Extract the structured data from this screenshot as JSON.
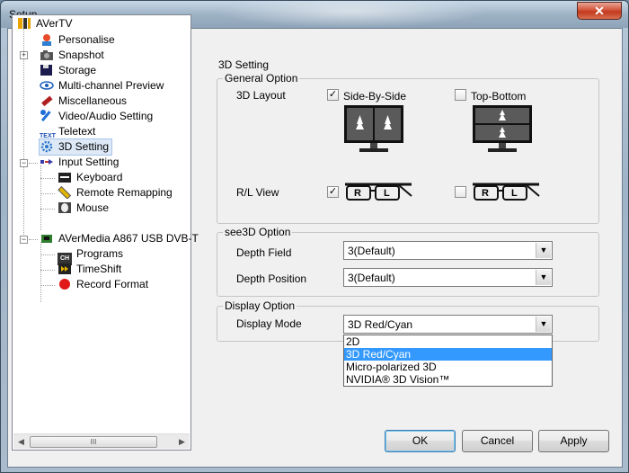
{
  "window": {
    "title": "Setup",
    "close_label": "✕"
  },
  "tree": {
    "root": "AVerTV",
    "items": [
      {
        "label": "Personalise",
        "icon": "personalise-icon"
      },
      {
        "label": "Snapshot",
        "icon": "camera-icon"
      },
      {
        "label": "Storage",
        "icon": "floppy-icon"
      },
      {
        "label": "Multi-channel Preview",
        "icon": "eye-icon"
      },
      {
        "label": "Miscellaneous",
        "icon": "tools-icon"
      },
      {
        "label": "Video/Audio Setting",
        "icon": "wrench-icon"
      },
      {
        "label": "Teletext",
        "icon": "text-icon",
        "icon_text": "TEXT"
      },
      {
        "label": "3D Setting",
        "icon": "gear-icon"
      },
      {
        "label": "Input Setting",
        "icon": "input-icon"
      },
      {
        "label": "Keyboard",
        "icon": "keyboard-icon"
      },
      {
        "label": "Remote Remapping",
        "icon": "remote-icon"
      },
      {
        "label": "Mouse",
        "icon": "mouse-icon"
      },
      {
        "label": "AVerMedia A867 USB DVB-T",
        "icon": "tuner-icon"
      },
      {
        "label": "Programs",
        "icon": "ch-icon",
        "icon_text": "CH"
      },
      {
        "label": "TimeShift",
        "icon": "timeshift-icon"
      },
      {
        "label": "Record Format",
        "icon": "record-icon"
      }
    ],
    "scroll_left": "◀",
    "scroll_right": "▶",
    "scroll_thumb": "III"
  },
  "panel": {
    "title": "3D Setting",
    "general": {
      "group_label": "General Option",
      "layout_label": "3D Layout",
      "side_by_side": {
        "label": "Side-By-Side",
        "checked": true
      },
      "top_bottom": {
        "label": "Top-Bottom",
        "checked": false
      },
      "rl_view_label": "R/L View",
      "rl_normal_checked": true,
      "rl_swapped_checked": false,
      "glasses_r": "R",
      "glasses_l": "L"
    },
    "see3d": {
      "group_label": "see3D Option",
      "depth_field_label": "Depth Field",
      "depth_field_value": "3(Default)",
      "depth_position_label": "Depth Position",
      "depth_position_value": "3(Default)"
    },
    "display": {
      "group_label": "Display Option",
      "mode_label": "Display Mode",
      "mode_value": "3D Red/Cyan",
      "options": [
        "2D",
        "3D Red/Cyan",
        "Micro-polarized 3D",
        "NVIDIA® 3D Vision™"
      ],
      "selected_index": 1
    }
  },
  "buttons": {
    "ok": "OK",
    "cancel": "Cancel",
    "apply": "Apply"
  },
  "colors": {
    "selection": "#3399ff",
    "tree_selected": "#dde9f7",
    "close": "#c23a1f"
  }
}
